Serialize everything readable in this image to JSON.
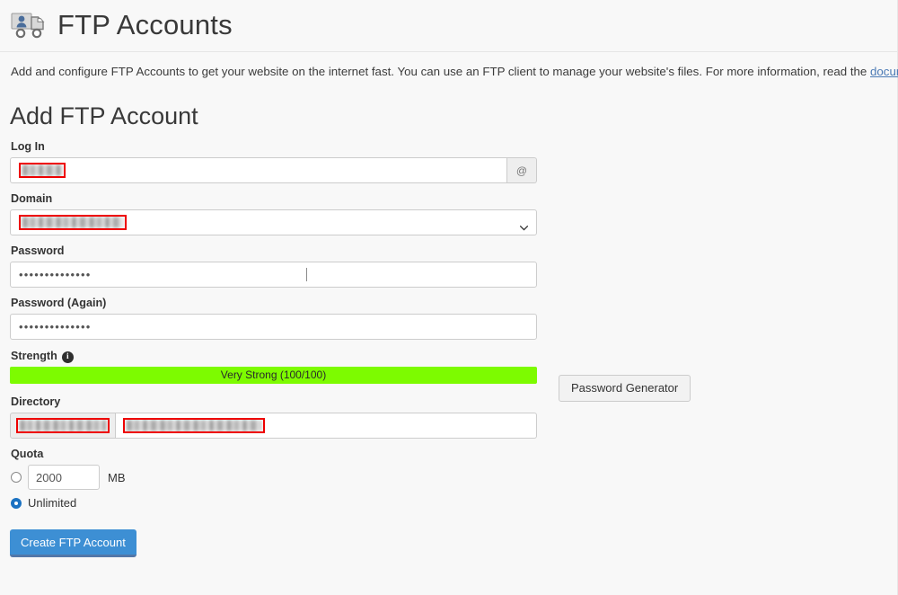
{
  "header": {
    "title": "FTP Accounts",
    "icon": "ftp-truck-user-icon"
  },
  "intro": {
    "text_before_link": "Add and configure FTP Accounts to get your website on the internet fast. You can use an FTP client to manage your website's files. For more information, read the ",
    "link_label": "documentation",
    "text_after_link": "."
  },
  "section": {
    "title": "Add FTP Account"
  },
  "form": {
    "login": {
      "label": "Log In",
      "value": "",
      "redacted": true,
      "addon": "@"
    },
    "domain": {
      "label": "Domain",
      "selected_value": "",
      "redacted": true
    },
    "password": {
      "label": "Password",
      "value": "••••••••••••••",
      "masked": true
    },
    "password_again": {
      "label": "Password (Again)",
      "value": "••••••••••••••",
      "masked": true
    },
    "strength": {
      "label": "Strength",
      "info_icon": "info-circle-icon",
      "bar_text": "Very Strong (100/100)",
      "percent": 100,
      "bar_color": "#7DFB00"
    },
    "password_generator": {
      "label": "Password Generator"
    },
    "directory": {
      "label": "Directory",
      "prefix_value": "",
      "input_value": "",
      "redacted": true
    },
    "quota": {
      "label": "Quota",
      "limited_value": "2000",
      "unit": "MB",
      "unlimited_label": "Unlimited",
      "selected": "unlimited"
    },
    "submit": {
      "label": "Create FTP Account"
    }
  },
  "colors": {
    "page_background": "#f8f8f8",
    "link": "#4b7ab5",
    "primary_button": "#3d8fd4",
    "strength_green": "#7DFB00",
    "redaction_box": "#ee0000"
  }
}
